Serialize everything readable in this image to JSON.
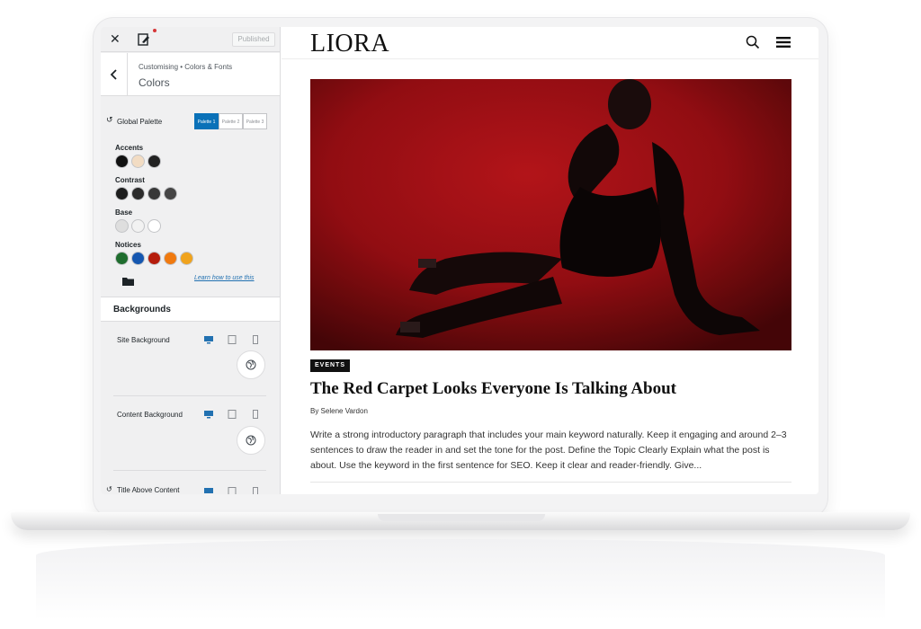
{
  "sidebar": {
    "published_label": "Published",
    "breadcrumb": "Customising • Colors & Fonts",
    "panel_title": "Colors",
    "global_palette": {
      "label": "Global Palette",
      "tabs": [
        "Palette 1",
        "Palette 2",
        "Palette 3"
      ],
      "active_tab": 0
    },
    "groups": [
      {
        "label": "Accents",
        "colors": [
          "#111111",
          "#f2dcc3",
          "#222222"
        ]
      },
      {
        "label": "Contrast",
        "colors": [
          "#1d1d1d",
          "#2b2b2b",
          "#383838",
          "#454545"
        ]
      },
      {
        "label": "Base",
        "colors": [
          "#dedede",
          "#f2f2f2",
          "#ffffff"
        ]
      },
      {
        "label": "Notices",
        "colors": [
          "#1f6d2e",
          "#1557b0",
          "#b51d0c",
          "#f07a10",
          "#f0a31d"
        ]
      }
    ],
    "learn_link": "Learn how to use this",
    "backgrounds_title": "Backgrounds",
    "options": [
      {
        "label": "Site Background"
      },
      {
        "label": "Content Background"
      },
      {
        "label": "Title Above Content"
      }
    ]
  },
  "preview": {
    "logo": "LIORA",
    "category_tag": "EVENTS",
    "post_title": "The Red Carpet Looks Everyone Is Talking About",
    "byline": "By Selene Vardon",
    "excerpt": "Write a strong introductory paragraph that includes your main keyword naturally. Keep it engaging and around 2–3 sentences to draw the reader in and set the tone for the post. Define the Topic Clearly Explain what the post is about. Use the keyword in the first sentence for SEO. Keep it clear and reader-friendly. Give..."
  },
  "colors": {
    "accent_blue": "#0a71b8",
    "hero_red": "#b01217"
  }
}
